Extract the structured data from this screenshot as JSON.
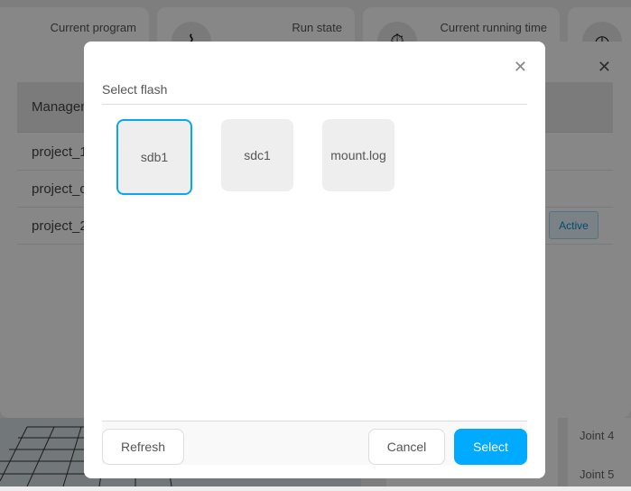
{
  "status_cards": [
    {
      "label": "Current program",
      "icon": "program-icon"
    },
    {
      "label": "Run state",
      "icon": "pulse-icon"
    },
    {
      "label": "Current running time",
      "icon": "stopwatch-icon"
    },
    {
      "label": "",
      "icon": "clock-icon"
    }
  ],
  "project_panel": {
    "header": "Management",
    "rows": [
      {
        "name": "project_1"
      },
      {
        "name": "project_cy"
      },
      {
        "name": "project_2",
        "badge": "Active"
      }
    ]
  },
  "joints": [
    "Joint 4",
    "Joint 5"
  ],
  "dialog": {
    "title": "Select flash",
    "items": [
      {
        "label": "sdb1",
        "selected": true
      },
      {
        "label": "sdc1"
      },
      {
        "label": "mount.log"
      }
    ],
    "refresh_label": "Refresh",
    "cancel_label": "Cancel",
    "select_label": "Select",
    "accent": "#00aaff"
  }
}
